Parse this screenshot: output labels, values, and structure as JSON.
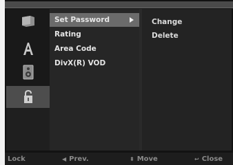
{
  "menu": {
    "items": [
      {
        "label": "Set Password"
      },
      {
        "label": "Rating"
      },
      {
        "label": "Area Code"
      },
      {
        "label": "DivX(R) VOD"
      }
    ],
    "selected_index": 0
  },
  "submenu": {
    "items": [
      {
        "label": "Change"
      },
      {
        "label": "Delete"
      }
    ]
  },
  "icons": [
    "disc-icon",
    "language-icon",
    "audio-icon",
    "lock-icon"
  ],
  "bottom_bar": {
    "section": "Lock",
    "prev": "Prev.",
    "move": "Move",
    "close": "Close"
  },
  "colors": {
    "highlight": "#6b6b6b",
    "selected_icon_bg": "#4d4d4d"
  }
}
